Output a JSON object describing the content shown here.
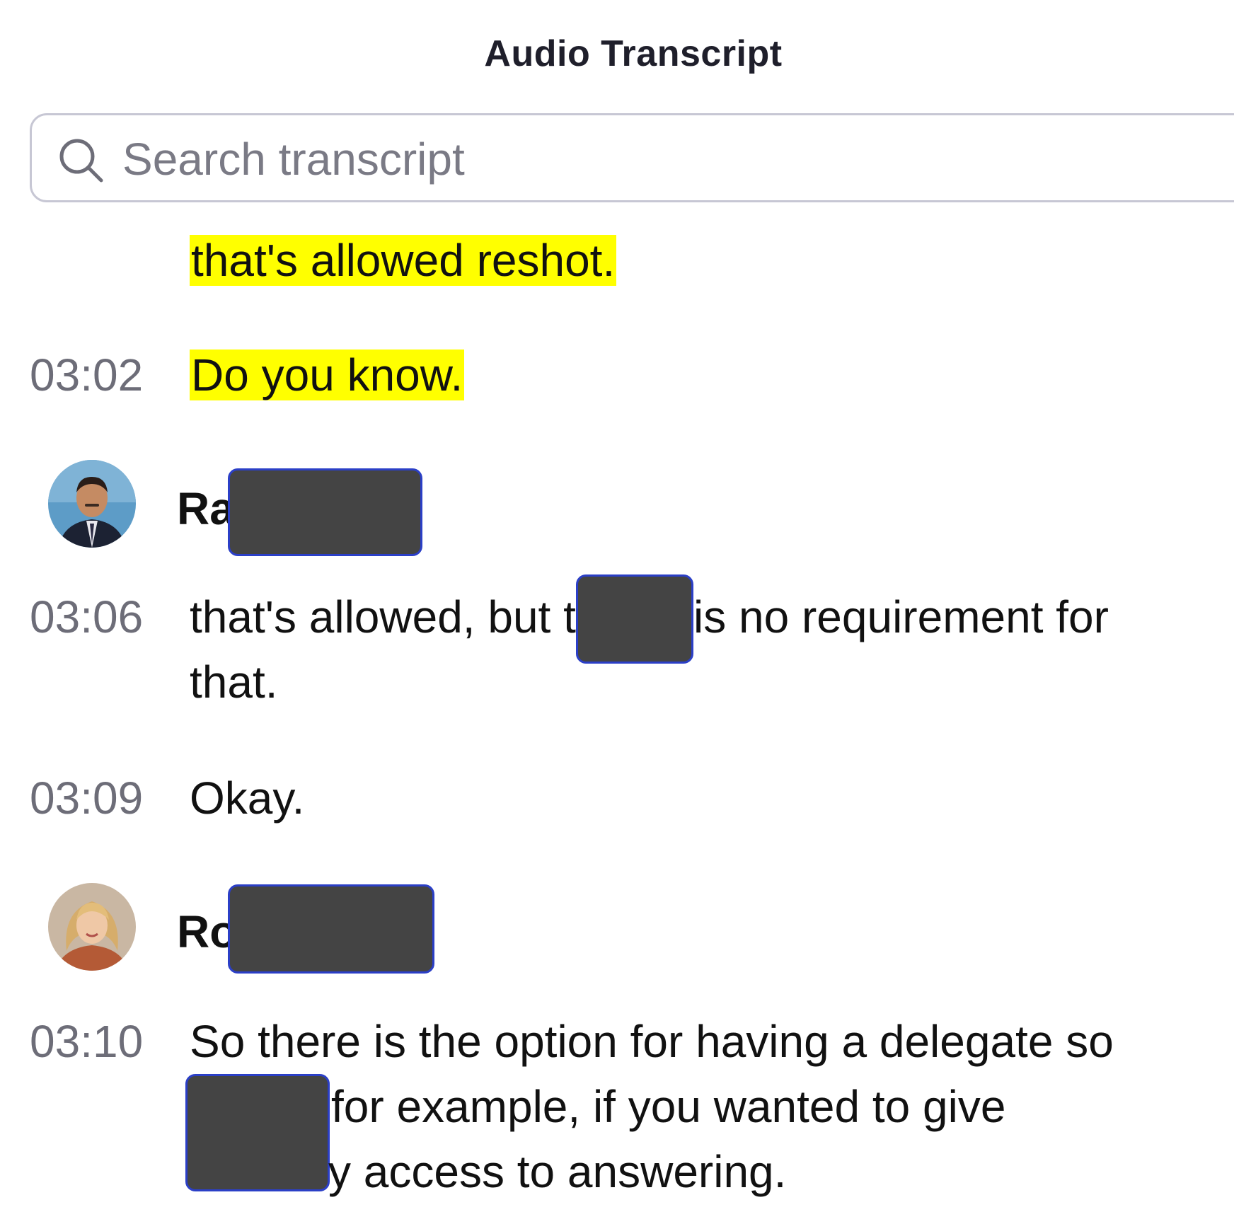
{
  "panel": {
    "title": "Audio Transcript"
  },
  "search": {
    "placeholder": "Search transcript",
    "value": ""
  },
  "entries": [
    {
      "time": "",
      "text": "that's allowed reshot.",
      "highlighted": true
    },
    {
      "time": "03:02",
      "text": "Do you know.",
      "highlighted": true
    },
    {
      "speaker_prefix": "Ra"
    },
    {
      "time": "03:06",
      "text_part1": "that's allowed, but t",
      "text_part2": "is no requirement for",
      "text_line2": "that."
    },
    {
      "time": "03:09",
      "text": "Okay."
    },
    {
      "speaker_prefix": "Ro"
    },
    {
      "time": "03:10",
      "text_line1": "So there is the option for having a delegate so",
      "text_line2": "for example, if you wanted to give",
      "text_line3": "y access to answering."
    }
  ],
  "colors": {
    "highlight": "#ffff00",
    "redaction_fill": "#444444",
    "redaction_border": "#2b3fc7",
    "timestamp": "#6d6d78"
  },
  "icons": {
    "search": "search-icon"
  }
}
